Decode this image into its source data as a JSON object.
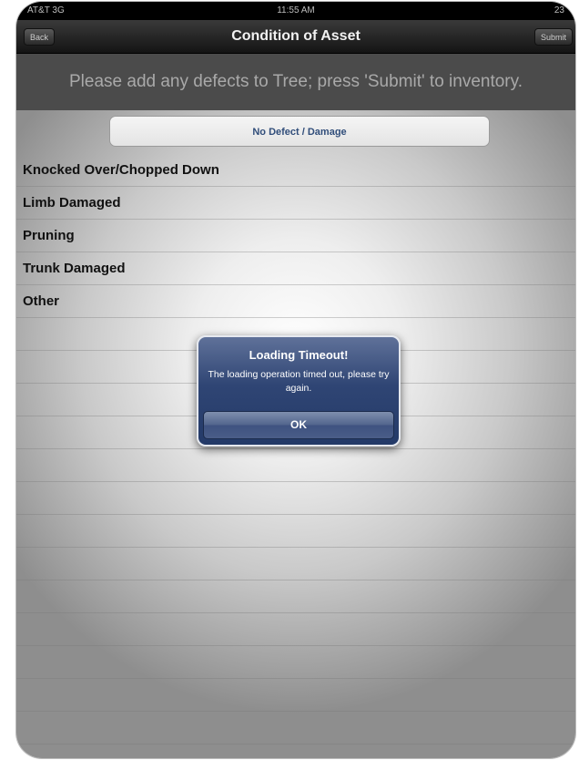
{
  "status_bar": {
    "carrier": "AT&T 3G",
    "time": "11:55 AM",
    "battery": "23"
  },
  "nav": {
    "back_label": "Back",
    "title": "Condition of Asset",
    "submit_label": "Submit"
  },
  "instruction": "Please add any defects to Tree; press 'Submit' to inventory.",
  "no_defect_label": "No Defect / Damage",
  "defects": [
    {
      "label": "Knocked Over/Chopped Down"
    },
    {
      "label": "Limb Damaged"
    },
    {
      "label": "Pruning"
    },
    {
      "label": "Trunk Damaged"
    },
    {
      "label": "Other"
    }
  ],
  "alert": {
    "title": "Loading Timeout!",
    "message": "The loading operation timed out, please try again.",
    "ok_label": "OK"
  }
}
